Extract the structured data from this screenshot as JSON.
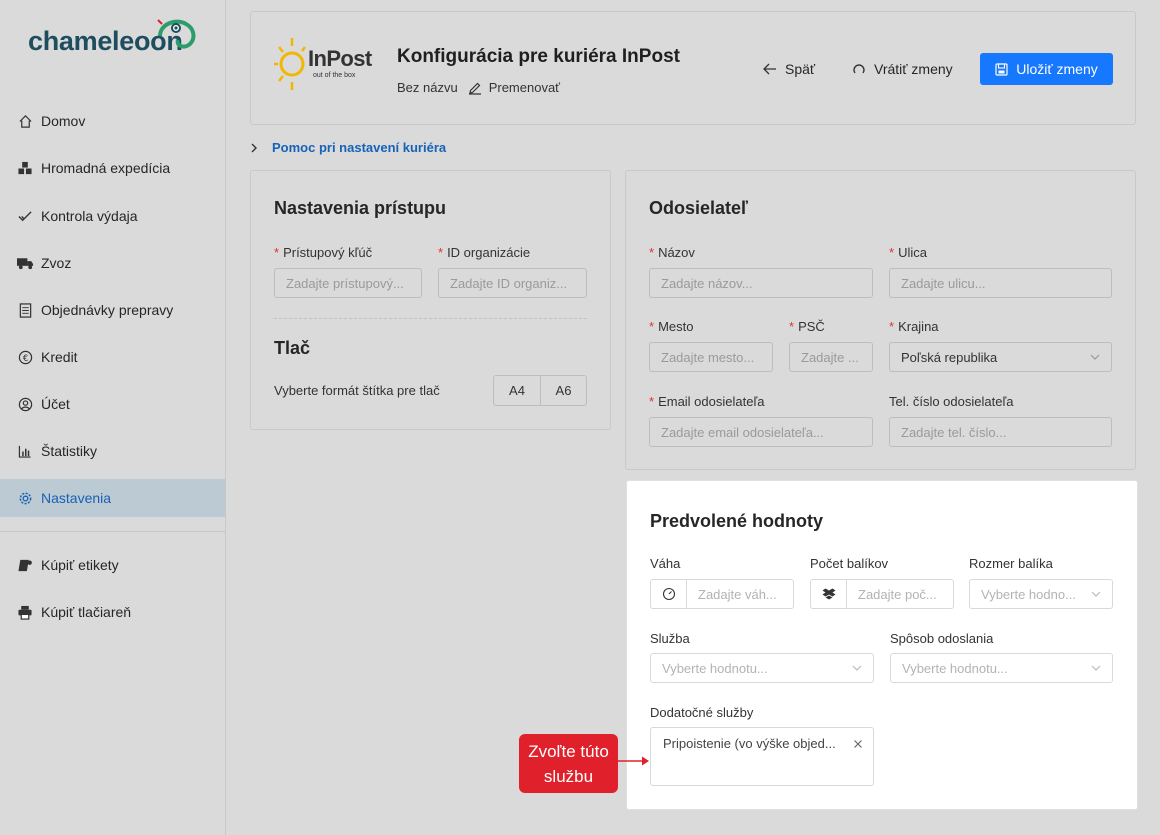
{
  "sidebar": {
    "logo_text": "chameleoon",
    "items": [
      {
        "label": "Domov",
        "icon": "home-icon"
      },
      {
        "label": "Hromadná expedícia",
        "icon": "boxes-icon"
      },
      {
        "label": "Kontrola výdaja",
        "icon": "double-check-icon"
      },
      {
        "label": "Zvoz",
        "icon": "truck-icon"
      },
      {
        "label": "Objednávky prepravy",
        "icon": "document-icon"
      },
      {
        "label": "Kredit",
        "icon": "euro-icon"
      },
      {
        "label": "Účet",
        "icon": "user-circle-icon"
      },
      {
        "label": "Štatistiky",
        "icon": "bar-chart-icon"
      },
      {
        "label": "Nastavenia",
        "icon": "gear-icon",
        "active": true
      },
      {
        "label": "Kúpiť etikety",
        "icon": "label-roll-icon"
      },
      {
        "label": "Kúpiť tlačiareň",
        "icon": "printer-icon"
      }
    ]
  },
  "header": {
    "logo_text": "InPost",
    "logo_tagline": "out of the box",
    "title": "Konfigurácia pre kuriéra InPost",
    "subtitle": "Bez názvu",
    "rename_label": "Premenovať",
    "back_label": "Späť",
    "revert_label": "Vrátiť zmeny",
    "save_label": "Uložiť zmeny",
    "accent_color": "#1677ff"
  },
  "help_link": "Pomoc pri nastavení kuriéra",
  "access": {
    "title": "Nastavenia prístupu",
    "key_label": "Prístupový kľúč",
    "key_placeholder": "Zadajte prístupový...",
    "org_label": "ID organizácie",
    "org_placeholder": "Zadajte ID organiz...",
    "print_title": "Tlač",
    "print_label": "Vyberte formát štítka pre tlač",
    "formats": [
      "A4",
      "A6"
    ]
  },
  "sender": {
    "title": "Odosielateľ",
    "name_label": "Názov",
    "name_placeholder": "Zadajte názov...",
    "street_label": "Ulica",
    "street_placeholder": "Zadajte ulicu...",
    "city_label": "Mesto",
    "city_placeholder": "Zadajte mesto...",
    "zip_label": "PSČ",
    "zip_placeholder": "Zadajte ...",
    "country_label": "Krajina",
    "country_value": "Poľská republika",
    "email_label": "Email odosielateľa",
    "email_placeholder": "Zadajte email odosielateľa...",
    "phone_label": "Tel. číslo odosielateľa",
    "phone_placeholder": "Zadajte tel. číslo..."
  },
  "defaults": {
    "title": "Predvolené hodnoty",
    "weight_label": "Váha",
    "weight_placeholder": "Zadajte váh...",
    "count_label": "Počet balíkov",
    "count_placeholder": "Zadajte poč...",
    "size_label": "Rozmer balíka",
    "size_placeholder": "Vyberte hodno...",
    "service_label": "Služba",
    "service_placeholder": "Vyberte hodnotu...",
    "shipping_label": "Spôsob odoslania",
    "shipping_placeholder": "Vyberte hodnotu...",
    "extra_label": "Dodatočné služby",
    "extra_tag": "Pripoistenie (vo výške objed..."
  },
  "callout": {
    "line1": "Zvoľte túto",
    "line2": "službu",
    "color": "#e0202a"
  }
}
